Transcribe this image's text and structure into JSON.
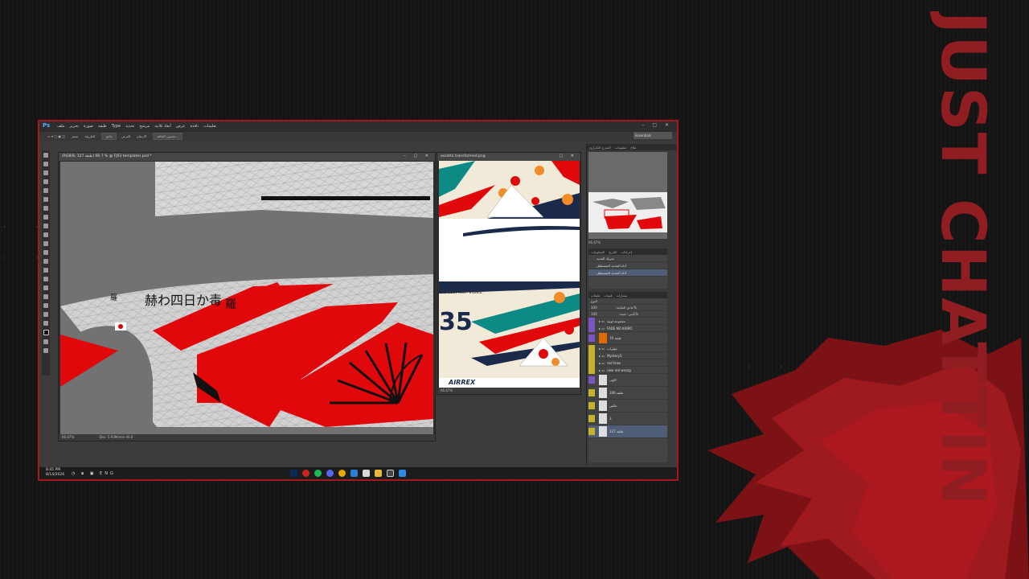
{
  "brand": {
    "text": "JUST CHATTIN"
  },
  "photoshop": {
    "logo": "Ps",
    "menu": [
      "ملف",
      "تحرير",
      "صورة",
      "طبقة",
      "Type",
      "تحديد",
      "مرشح",
      "أبعاد ثلاثية",
      "عرض",
      "نافذة",
      "تعليمات"
    ],
    "window_controls": "–  ▢  ✕",
    "options": {
      "items": [
        "تنعيم",
        "الطريقة",
        "عادي",
        "العرض",
        "الارتفاع"
      ],
      "refine_button": "تحسين الحافة...",
      "workspace": "Essentials"
    },
    "doc1": {
      "title": "(RGB/8, 127 طبقة) 66.7 % @ FJ03 templates.psd *",
      "zoom": "66.67%",
      "status": "Doc: 5.93M/min 40.0",
      "controls": "–  ▢  ✕"
    },
    "doc2": {
      "title": "assetto transformed.png",
      "status": "66.67%",
      "controls": "▢  ✕",
      "stress_text": "Stress. Nor Vibes.",
      "number": "35",
      "logo_text": "AIRREX"
    },
    "panels": {
      "tabs_top": [
        "المدرج التكراري",
        "معلومات",
        "ملاح"
      ],
      "nav_zoom": "66.67%",
      "history_tabs": [
        "المعلومات",
        "التاريخ",
        "إجراءات"
      ],
      "history": [
        "تحريك الحديد",
        "أداة التحديد المستطيل",
        "أداة التحديد المستطيل"
      ],
      "layer_tabs": [
        "طبقات",
        "قنوات",
        "مسارات"
      ],
      "layer_kind": "النوع",
      "blend_mode": "عادي",
      "opacity_label": "العتامة:",
      "opacity": "100%",
      "lock_label": "تأمين:",
      "fill_label": "تعبئة:",
      "fill": "100%",
      "layers": [
        {
          "name": "مجموعة لونية",
          "tag": "v",
          "thumb": "none",
          "big": false
        },
        {
          "name": "FADE NO KAIRO",
          "tag": "v",
          "thumb": "none",
          "big": false
        },
        {
          "name": "طبقة 70",
          "tag": "v",
          "thumb": "orange",
          "big": true
        },
        {
          "name": "مؤثرات",
          "tag": "y",
          "thumb": "none",
          "big": false
        },
        {
          "name": "Mystery3",
          "tag": "y",
          "thumb": "none",
          "big": false
        },
        {
          "name": "red lines",
          "tag": "y",
          "thumb": "none",
          "big": false
        },
        {
          "name": "new red wrong",
          "tag": "y",
          "thumb": "none",
          "big": false
        },
        {
          "name": "اللون",
          "tag": "v",
          "thumb": "white",
          "big": true
        },
        {
          "name": "طبقة 106",
          "tag": "y",
          "thumb": "white",
          "big": true
        },
        {
          "name": "عكس",
          "tag": "y",
          "thumb": "white",
          "big": true
        },
        {
          "name": "3",
          "tag": "y",
          "thumb": "white",
          "big": true
        },
        {
          "name": "طبقة 127",
          "tag": "y",
          "thumb": "white",
          "big": true,
          "selected": true
        }
      ]
    }
  },
  "taskbar": {
    "time": "8:45 PM",
    "date": "8/14/2026",
    "lang": "ENG",
    "tray_glyphs": "◷ ⧈ ▣"
  },
  "colors": {
    "accent_red": "#e0080a",
    "frame_red": "#a3181d",
    "brand_red": "#8f1d21",
    "ps_blue": "#5aa9ff"
  }
}
